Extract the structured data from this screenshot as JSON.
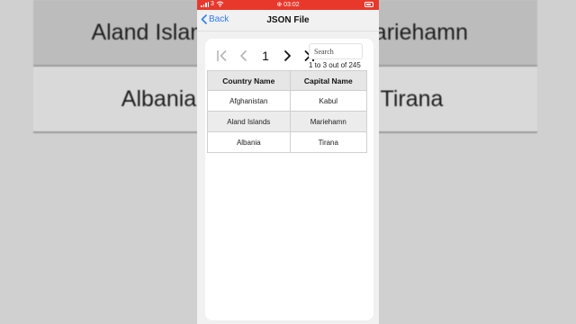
{
  "background": {
    "rows": [
      {
        "left": "Aland Islands",
        "right": "Mariehamn",
        "shade": true
      },
      {
        "left": "Albania",
        "right": "Tirana",
        "shade": false
      }
    ]
  },
  "status_bar": {
    "carrier": "3",
    "time": "03:02",
    "color": "#e8382c"
  },
  "nav": {
    "back_label": "Back",
    "title": "JSON File",
    "accent": "#2f7cf6"
  },
  "pager": {
    "current_page": "1",
    "search_placeholder": "Search",
    "count_text": "1 to 3 out of 245"
  },
  "table": {
    "headers": [
      "Country Name",
      "Capital Name"
    ],
    "rows": [
      [
        "Afghanistan",
        "Kabul"
      ],
      [
        "Aland Islands",
        "Mariehamn"
      ],
      [
        "Albania",
        "Tirana"
      ]
    ]
  }
}
